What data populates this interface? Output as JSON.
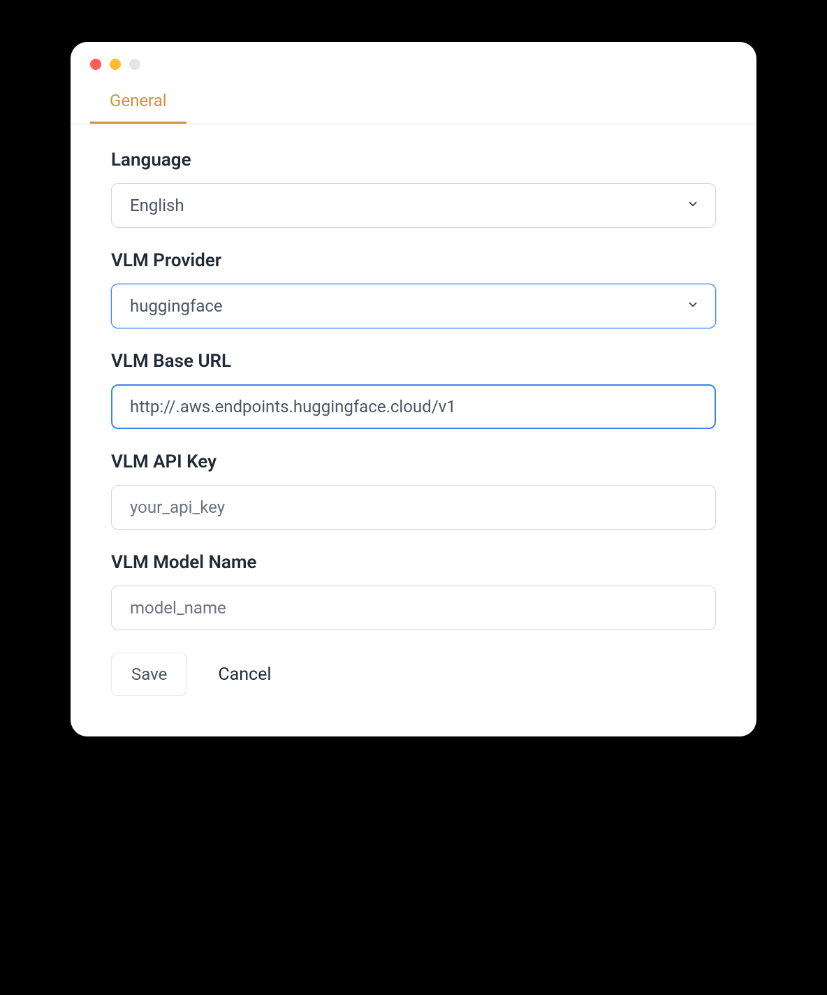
{
  "tabs": {
    "general": "General"
  },
  "fields": {
    "language": {
      "label": "Language",
      "value": "English"
    },
    "vlm_provider": {
      "label": "VLM Provider",
      "value": "huggingface"
    },
    "vlm_base_url": {
      "label": "VLM Base URL",
      "value": "http://.aws.endpoints.huggingface.cloud/v1"
    },
    "vlm_api_key": {
      "label": "VLM API Key",
      "placeholder": "your_api_key",
      "value": ""
    },
    "vlm_model_name": {
      "label": "VLM Model Name",
      "placeholder": "model_name",
      "value": ""
    }
  },
  "actions": {
    "save": "Save",
    "cancel": "Cancel"
  }
}
